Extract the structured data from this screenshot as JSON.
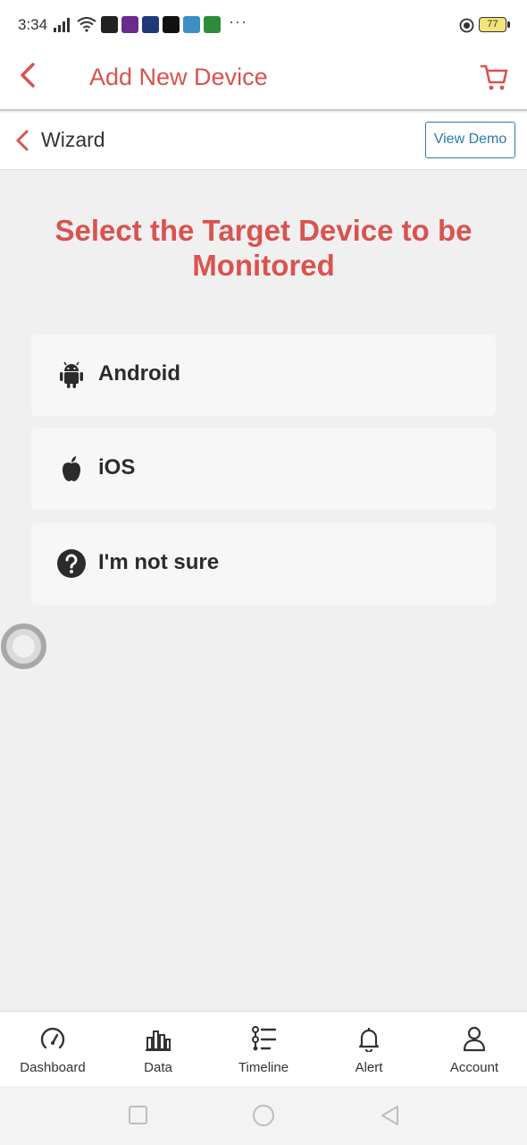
{
  "status_bar": {
    "time": "3:34",
    "battery": "77"
  },
  "app_bar": {
    "title": "Add New Device",
    "back_icon": "chevron-left-icon",
    "cart_icon": "cart-icon",
    "accent_color": "#d9534f"
  },
  "wizard_bar": {
    "label": "Wizard",
    "demo_button": "View Demo"
  },
  "main": {
    "headline": "Select the Target Device to be Monitored",
    "options": [
      {
        "label": "Android",
        "icon": "android-icon"
      },
      {
        "label": "iOS",
        "icon": "apple-icon"
      },
      {
        "label": "I'm not sure",
        "icon": "question-icon"
      }
    ]
  },
  "bottom_nav": {
    "items": [
      {
        "label": "Dashboard",
        "icon": "gauge-icon"
      },
      {
        "label": "Data",
        "icon": "bar-chart-icon"
      },
      {
        "label": "Timeline",
        "icon": "timeline-icon"
      },
      {
        "label": "Alert",
        "icon": "bell-icon"
      },
      {
        "label": "Account",
        "icon": "user-icon"
      }
    ]
  }
}
